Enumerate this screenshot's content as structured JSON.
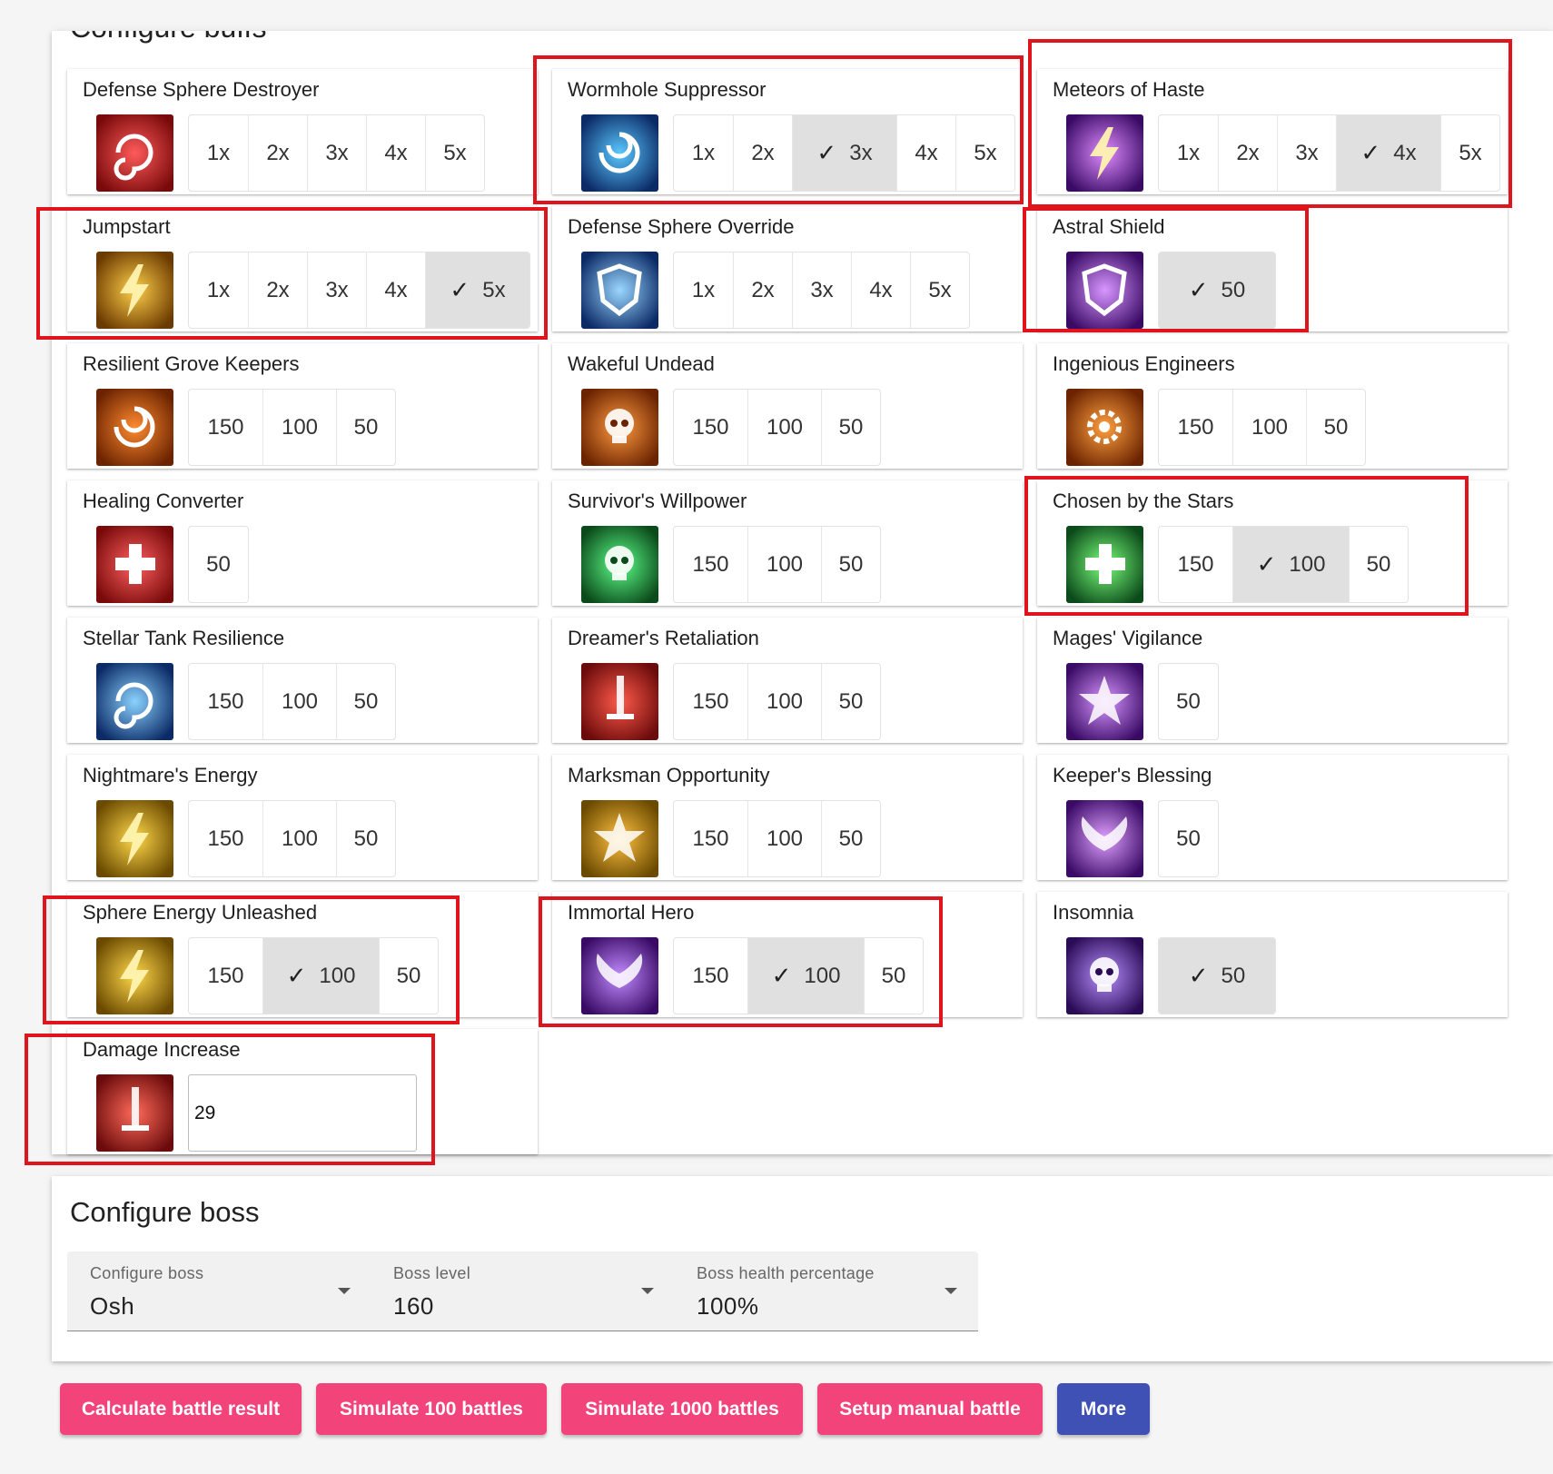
{
  "buffs_section": {
    "title": "Configure buffs"
  },
  "icons": [
    "defense-sphere-destroyer-icon",
    "wormhole-suppressor-icon",
    "meteors-of-haste-icon",
    "jumpstart-icon",
    "defense-sphere-override-icon",
    "astral-shield-icon",
    "resilient-grove-keepers-icon",
    "wakeful-undead-icon",
    "ingenious-engineers-icon",
    "healing-converter-icon",
    "survivors-willpower-icon",
    "chosen-by-the-stars-icon",
    "stellar-tank-resilience-icon",
    "dreamers-retaliation-icon",
    "mages-vigilance-icon",
    "nightmares-energy-icon",
    "marksman-opportunity-icon",
    "keepers-blessing-icon",
    "sphere-energy-unleashed-icon",
    "immortal-hero-icon",
    "insomnia-icon",
    "damage-increase-icon"
  ],
  "buffs": [
    {
      "name": "Defense Sphere Destroyer",
      "options": [
        "1x",
        "2x",
        "3x",
        "4x",
        "5x"
      ],
      "selected": null
    },
    {
      "name": "Wormhole Suppressor",
      "options": [
        "1x",
        "2x",
        "3x",
        "4x",
        "5x"
      ],
      "selected": 2
    },
    {
      "name": "Meteors of Haste",
      "options": [
        "1x",
        "2x",
        "3x",
        "4x",
        "5x"
      ],
      "selected": 3
    },
    {
      "name": "Jumpstart",
      "options": [
        "1x",
        "2x",
        "3x",
        "4x",
        "5x"
      ],
      "selected": 4
    },
    {
      "name": "Defense Sphere Override",
      "options": [
        "1x",
        "2x",
        "3x",
        "4x",
        "5x"
      ],
      "selected": null
    },
    {
      "name": "Astral Shield",
      "options": [
        "50"
      ],
      "selected": 0
    },
    {
      "name": "Resilient Grove Keepers",
      "options": [
        "150",
        "100",
        "50"
      ],
      "selected": null
    },
    {
      "name": "Wakeful Undead",
      "options": [
        "150",
        "100",
        "50"
      ],
      "selected": null
    },
    {
      "name": "Ingenious Engineers",
      "options": [
        "150",
        "100",
        "50"
      ],
      "selected": null
    },
    {
      "name": "Healing Converter",
      "options": [
        "50"
      ],
      "selected": null
    },
    {
      "name": "Survivor's Willpower",
      "options": [
        "150",
        "100",
        "50"
      ],
      "selected": null
    },
    {
      "name": "Chosen by the Stars",
      "options": [
        "150",
        "100",
        "50"
      ],
      "selected": 1
    },
    {
      "name": "Stellar Tank Resilience",
      "options": [
        "150",
        "100",
        "50"
      ],
      "selected": null
    },
    {
      "name": "Dreamer's Retaliation",
      "options": [
        "150",
        "100",
        "50"
      ],
      "selected": null
    },
    {
      "name": "Mages' Vigilance",
      "options": [
        "50"
      ],
      "selected": null
    },
    {
      "name": "Nightmare's Energy",
      "options": [
        "150",
        "100",
        "50"
      ],
      "selected": null
    },
    {
      "name": "Marksman Opportunity",
      "options": [
        "150",
        "100",
        "50"
      ],
      "selected": null
    },
    {
      "name": "Keeper's Blessing",
      "options": [
        "50"
      ],
      "selected": null
    },
    {
      "name": "Sphere Energy Unleashed",
      "options": [
        "150",
        "100",
        "50"
      ],
      "selected": 1
    },
    {
      "name": "Immortal Hero",
      "options": [
        "150",
        "100",
        "50"
      ],
      "selected": 1
    },
    {
      "name": "Insomnia",
      "options": [
        "50"
      ],
      "selected": 0
    },
    {
      "name": "Damage Increase",
      "input_value": "29"
    }
  ],
  "boss_section": {
    "title": "Configure boss",
    "fields": [
      {
        "label": "Configure boss",
        "value": "Osh"
      },
      {
        "label": "Boss level",
        "value": "160"
      },
      {
        "label": "Boss health percentage",
        "value": "100%"
      }
    ]
  },
  "actions": [
    "Calculate battle result",
    "Simulate 100 battles",
    "Simulate 1000 battles",
    "Setup manual battle",
    "More"
  ],
  "colors": {
    "accent_pink": "#f2437b",
    "accent_indigo": "#3f51b5",
    "highlight_red": "#e0141c",
    "selected_bg": "#e0e0e0"
  }
}
